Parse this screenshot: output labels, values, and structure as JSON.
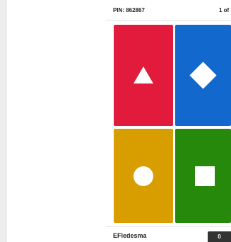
{
  "header": {
    "pin": "PIN: 862867",
    "counter": "1 of"
  },
  "answers": [
    {
      "color": "#e21b3c",
      "shape": "triangle"
    },
    {
      "color": "#1368ce",
      "shape": "diamond"
    },
    {
      "color": "#d89e00",
      "shape": "circle"
    },
    {
      "color": "#26890c",
      "shape": "square"
    }
  ],
  "footer": {
    "player_name": "EFledesma",
    "score": "0"
  }
}
